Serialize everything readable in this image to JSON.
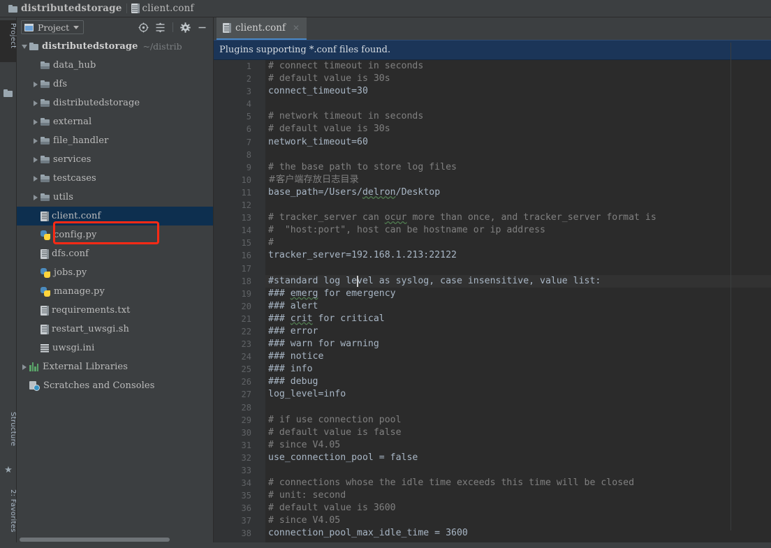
{
  "breadcrumb": {
    "project_name": "distributedstorage",
    "file_name": "client.conf",
    "folder_icon": "folder-icon",
    "file_icon": "conf-file-icon"
  },
  "left_strip": {
    "project_tab": "Project",
    "structure_tab": "Structure",
    "favorites_tab": "2: Favorites",
    "star_icon": "star-icon",
    "folder_icon": "folder-icon",
    "grid_icon": "grid-icon"
  },
  "project_panel": {
    "title": "Project",
    "dropdown_icon": "chevron-down-icon",
    "toolbar": {
      "scroll_from_source": "target-icon",
      "collapse_all": "collapse-all-icon",
      "settings": "gear-icon",
      "hide": "minimize-icon"
    },
    "tree": [
      {
        "label": "distributedstorage",
        "sub": "~/distrib",
        "indent": 0,
        "arrow": "down",
        "icon": "folder-icon",
        "bold": true,
        "selected": false
      },
      {
        "label": "data_hub",
        "sub": "",
        "indent": 1,
        "arrow": "none",
        "icon": "module-folder-icon",
        "bold": false,
        "selected": false
      },
      {
        "label": "dfs",
        "sub": "",
        "indent": 1,
        "arrow": "right",
        "icon": "module-folder-icon",
        "bold": false,
        "selected": false
      },
      {
        "label": "distributedstorage",
        "sub": "",
        "indent": 1,
        "arrow": "right",
        "icon": "module-folder-icon",
        "bold": false,
        "selected": false
      },
      {
        "label": "external",
        "sub": "",
        "indent": 1,
        "arrow": "right",
        "icon": "module-folder-icon",
        "bold": false,
        "selected": false
      },
      {
        "label": "file_handler",
        "sub": "",
        "indent": 1,
        "arrow": "right",
        "icon": "module-folder-icon",
        "bold": false,
        "selected": false
      },
      {
        "label": "services",
        "sub": "",
        "indent": 1,
        "arrow": "right",
        "icon": "module-folder-icon",
        "bold": false,
        "selected": false
      },
      {
        "label": "testcases",
        "sub": "",
        "indent": 1,
        "arrow": "right",
        "icon": "module-folder-icon",
        "bold": false,
        "selected": false
      },
      {
        "label": "utils",
        "sub": "",
        "indent": 1,
        "arrow": "right",
        "icon": "module-folder-icon",
        "bold": false,
        "selected": false
      },
      {
        "label": "client.conf",
        "sub": "",
        "indent": 1,
        "arrow": "none",
        "icon": "conf-file-icon",
        "bold": false,
        "selected": true
      },
      {
        "label": "config.py",
        "sub": "",
        "indent": 1,
        "arrow": "none",
        "icon": "python-file-icon",
        "bold": false,
        "selected": false
      },
      {
        "label": "dfs.conf",
        "sub": "",
        "indent": 1,
        "arrow": "none",
        "icon": "conf-file-icon",
        "bold": false,
        "selected": false
      },
      {
        "label": "jobs.py",
        "sub": "",
        "indent": 1,
        "arrow": "none",
        "icon": "python-file-icon",
        "bold": false,
        "selected": false
      },
      {
        "label": "manage.py",
        "sub": "",
        "indent": 1,
        "arrow": "none",
        "icon": "python-file-icon",
        "bold": false,
        "selected": false
      },
      {
        "label": "requirements.txt",
        "sub": "",
        "indent": 1,
        "arrow": "none",
        "icon": "conf-file-icon",
        "bold": false,
        "selected": false
      },
      {
        "label": "restart_uwsgi.sh",
        "sub": "",
        "indent": 1,
        "arrow": "none",
        "icon": "conf-file-icon",
        "bold": false,
        "selected": false
      },
      {
        "label": "uwsgi.ini",
        "sub": "",
        "indent": 1,
        "arrow": "none",
        "icon": "ini-file-icon",
        "bold": false,
        "selected": false
      },
      {
        "label": "External Libraries",
        "sub": "",
        "indent": 0,
        "arrow": "right",
        "icon": "library-icon",
        "bold": false,
        "selected": false
      },
      {
        "label": "Scratches and Consoles",
        "sub": "",
        "indent": 0,
        "arrow": "none",
        "icon": "scratches-icon",
        "bold": false,
        "selected": false
      }
    ],
    "annotation": {
      "type": "red-rectangle",
      "color": "#ff2a15",
      "targets": "client.conf"
    }
  },
  "editor": {
    "tab_label": "client.conf",
    "tab_icon": "conf-file-icon",
    "tab_close_icon": "close-icon",
    "tab_accent_color": "#4a88c7",
    "notification": "Plugins supporting *.conf files found.",
    "notification_bg": "#1b3558",
    "current_line": 18,
    "caret_line": 18,
    "caret_column": 16,
    "first_line": 1,
    "last_visible_line": 38,
    "lines": [
      {
        "n": 1,
        "text": "# connect timeout in seconds",
        "kind": "comment"
      },
      {
        "n": 2,
        "text": "# default value is 30s",
        "kind": "comment"
      },
      {
        "n": 3,
        "text": "connect_timeout=30",
        "kind": "text"
      },
      {
        "n": 4,
        "text": "",
        "kind": "text"
      },
      {
        "n": 5,
        "text": "# network timeout in seconds",
        "kind": "comment"
      },
      {
        "n": 6,
        "text": "# default value is 30s",
        "kind": "comment"
      },
      {
        "n": 7,
        "text": "network_timeout=60",
        "kind": "text"
      },
      {
        "n": 8,
        "text": "",
        "kind": "text"
      },
      {
        "n": 9,
        "text": "# the base path to store log files",
        "kind": "comment"
      },
      {
        "n": 10,
        "text": "#客户端存放日志目录",
        "kind": "comment-cn"
      },
      {
        "n": 11,
        "text": "base_path=/Users/delron/Desktop",
        "kind": "text",
        "typo": "delron"
      },
      {
        "n": 12,
        "text": "",
        "kind": "text"
      },
      {
        "n": 13,
        "text": "# tracker_server can ocur more than once, and tracker_server format is",
        "kind": "comment",
        "typo": "ocur"
      },
      {
        "n": 14,
        "text": "#  \"host:port\", host can be hostname or ip address",
        "kind": "comment"
      },
      {
        "n": 15,
        "text": "#",
        "kind": "comment"
      },
      {
        "n": 16,
        "text": "tracker_server=192.168.1.213:22122",
        "kind": "text"
      },
      {
        "n": 17,
        "text": "",
        "kind": "text"
      },
      {
        "n": 18,
        "text": "#standard log level as syslog, case insensitive, value list:",
        "kind": "text"
      },
      {
        "n": 19,
        "text": "### emerg for emergency",
        "kind": "text",
        "typo": "emerg"
      },
      {
        "n": 20,
        "text": "### alert",
        "kind": "text"
      },
      {
        "n": 21,
        "text": "### crit for critical",
        "kind": "text",
        "typo": "crit"
      },
      {
        "n": 22,
        "text": "### error",
        "kind": "text"
      },
      {
        "n": 23,
        "text": "### warn for warning",
        "kind": "text"
      },
      {
        "n": 24,
        "text": "### notice",
        "kind": "text"
      },
      {
        "n": 25,
        "text": "### info",
        "kind": "text"
      },
      {
        "n": 26,
        "text": "### debug",
        "kind": "text"
      },
      {
        "n": 27,
        "text": "log_level=info",
        "kind": "text"
      },
      {
        "n": 28,
        "text": "",
        "kind": "text"
      },
      {
        "n": 29,
        "text": "# if use connection pool",
        "kind": "comment"
      },
      {
        "n": 30,
        "text": "# default value is false",
        "kind": "comment"
      },
      {
        "n": 31,
        "text": "# since V4.05",
        "kind": "comment"
      },
      {
        "n": 32,
        "text": "use_connection_pool = false",
        "kind": "text"
      },
      {
        "n": 33,
        "text": "",
        "kind": "text"
      },
      {
        "n": 34,
        "text": "# connections whose the idle time exceeds this time will be closed",
        "kind": "comment"
      },
      {
        "n": 35,
        "text": "# unit: second",
        "kind": "comment"
      },
      {
        "n": 36,
        "text": "# default value is 3600",
        "kind": "comment"
      },
      {
        "n": 37,
        "text": "# since V4.05",
        "kind": "comment"
      },
      {
        "n": 38,
        "text": "connection_pool_max_idle_time = 3600",
        "kind": "text"
      }
    ]
  }
}
